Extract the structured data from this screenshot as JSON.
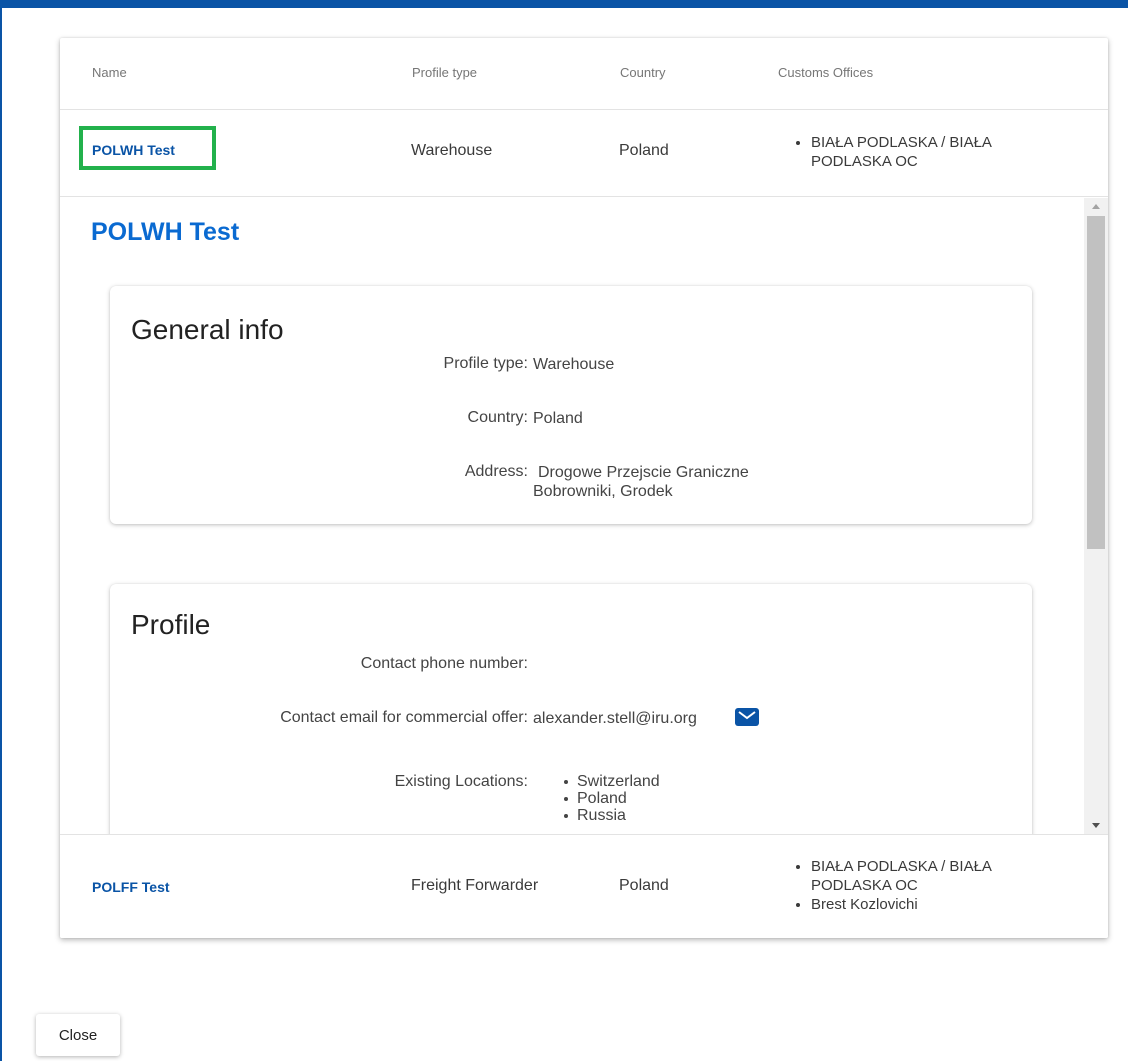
{
  "colors": {
    "accent": "#0a54a6",
    "title_link": "#0a6ad1",
    "highlight": "#22b14c"
  },
  "table": {
    "headers": {
      "name": "Name",
      "profile_type": "Profile type",
      "country": "Country",
      "customs_offices": "Customs Offices"
    },
    "rows": [
      {
        "name": "POLWH Test",
        "profile_type": "Warehouse",
        "country": "Poland",
        "customs_offices": [
          "BIAŁA PODLASKA / BIAŁA PODLASKA OC"
        ]
      },
      {
        "name": "POLFF Test",
        "profile_type": "Freight Forwarder",
        "country": "Poland",
        "customs_offices": [
          "BIAŁA PODLASKA / BIAŁA PODLASKA OC",
          "Brest Kozlovichi"
        ]
      }
    ]
  },
  "detail": {
    "title": "POLWH Test",
    "general_info": {
      "heading": "General info",
      "profile_type_label": "Profile type:",
      "profile_type_value": "Warehouse",
      "country_label": "Country:",
      "country_value": "Poland",
      "address_label": "Address:",
      "address_line1": "Drogowe Przejscie Graniczne",
      "address_line2": "Bobrowniki, Grodek"
    },
    "profile": {
      "heading": "Profile",
      "phone_label": "Contact phone number:",
      "phone_value": "",
      "email_label": "Contact email for commercial offer:",
      "email_value": "alexander.stell@iru.org",
      "email_icon": "mail-icon",
      "locations_label": "Existing Locations:",
      "locations": [
        "Switzerland",
        "Poland",
        "Russia"
      ]
    }
  },
  "footer": {
    "close_label": "Close"
  }
}
